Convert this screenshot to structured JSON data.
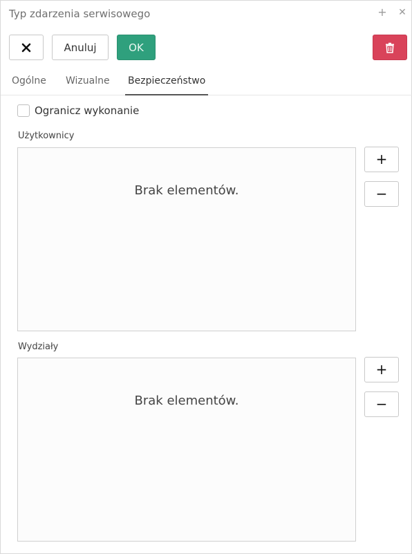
{
  "window": {
    "title": "Typ zdarzenia serwisowego",
    "maximize_glyph": "+",
    "close_glyph": "✕"
  },
  "toolbar": {
    "close_glyph": "✕",
    "cancel_label": "Anuluj",
    "ok_label": "OK",
    "ok_color": "#2fa07d",
    "delete_color": "#d9435a",
    "delete_icon": "trash-icon"
  },
  "tabs": [
    {
      "label": "Ogólne",
      "active": false
    },
    {
      "label": "Wizualne",
      "active": false
    },
    {
      "label": "Bezpieczeństwo",
      "active": true
    }
  ],
  "security": {
    "restrict_label": "Ogranicz wykonanie",
    "restrict_checked": false,
    "users": {
      "label": "Użytkownicy",
      "empty_text": "Brak elementów.",
      "add_glyph": "+",
      "remove_glyph": "−"
    },
    "departments": {
      "label": "Wydziały",
      "empty_text": "Brak elementów.",
      "add_glyph": "+",
      "remove_glyph": "−"
    }
  }
}
